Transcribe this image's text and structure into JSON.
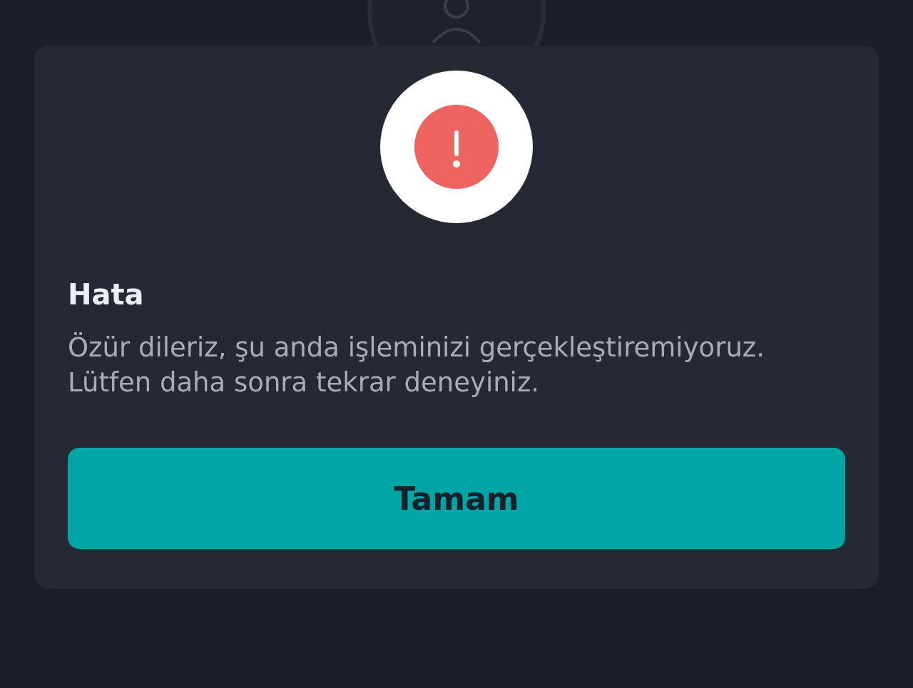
{
  "dialog": {
    "title": "Hata",
    "message": [
      "Özür dileriz, şu anda işleminizi gerçekleştiremiyoruz.",
      "Lütfen daha sonra tekrar deneyiniz."
    ],
    "button": "Tamam"
  }
}
